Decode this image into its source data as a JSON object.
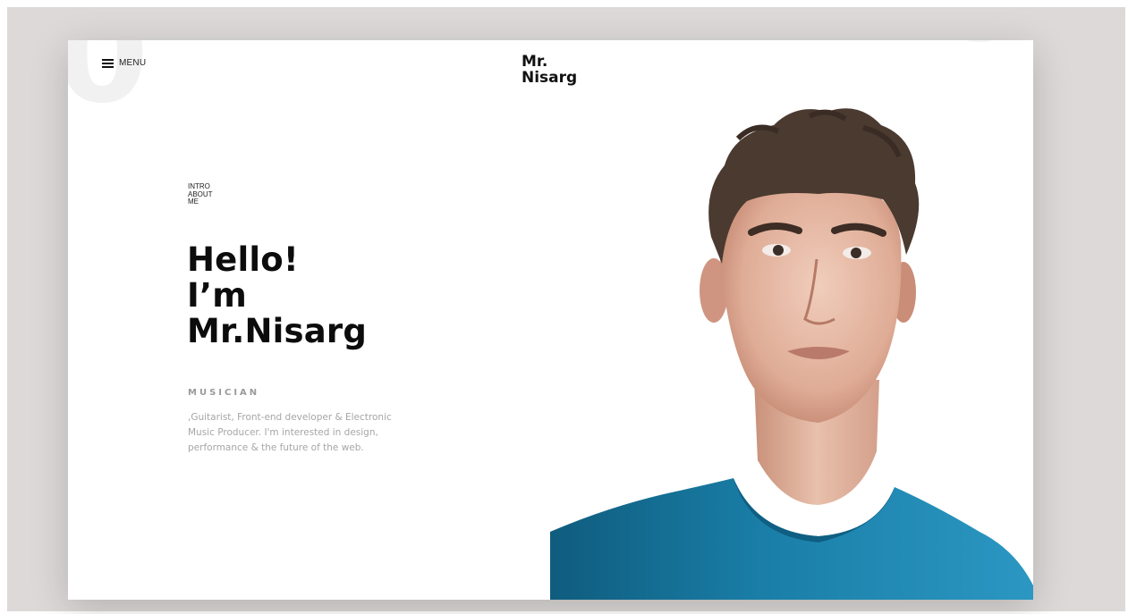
{
  "header": {
    "menu_label": "MENU",
    "logo_line1": "Mr.",
    "logo_line2": "Nisarg",
    "icon": "hamburger-icon"
  },
  "intro": {
    "lines": [
      "INTRO",
      "ABOUT",
      "ME"
    ]
  },
  "hero": {
    "headline_lines": [
      "Hello!",
      "I’m",
      "Mr.Nisarg"
    ],
    "role": "MUSICIAN",
    "bio": ",Guitarist, Front-end developer & Electronic Music Producer. I'm interested in design, performance & the future of the web."
  },
  "colors": {
    "frame": "#dcd9d8",
    "text": "#0c0c0c",
    "muted": "#9a9a9a",
    "shirt": "#1a7fa8"
  }
}
